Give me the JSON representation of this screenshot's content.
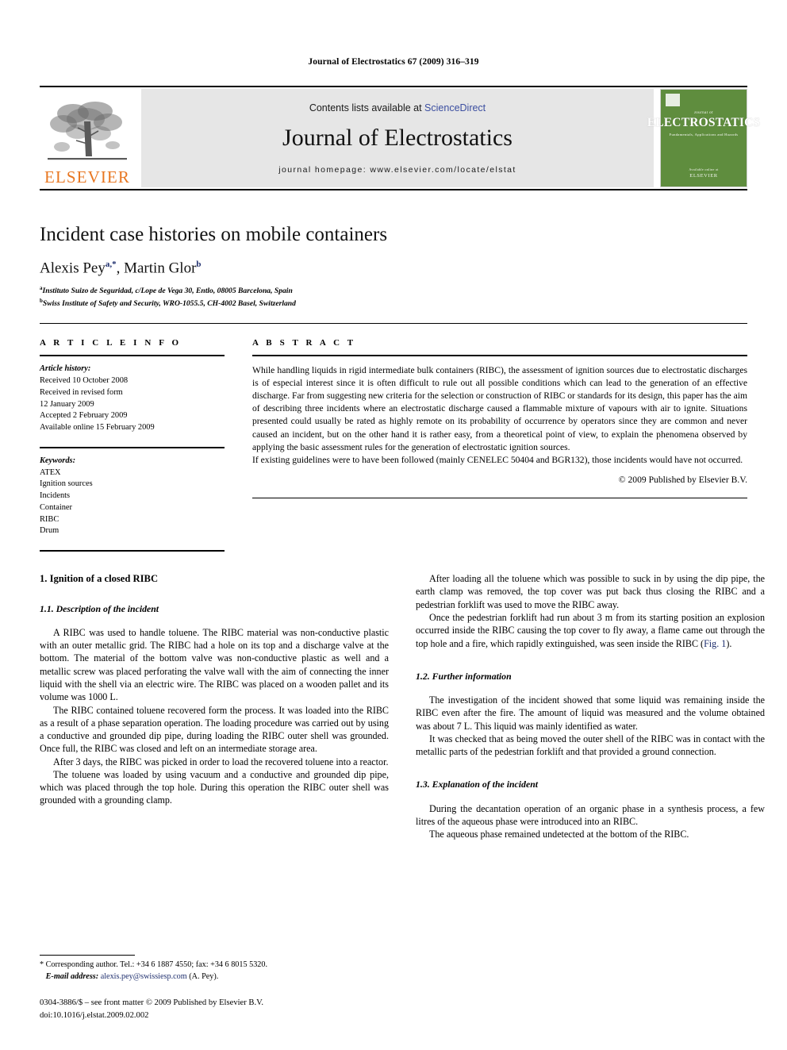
{
  "running_head": "Journal of Electrostatics 67 (2009) 316–319",
  "masthead": {
    "contents_prefix": "Contents lists available at ",
    "sciencedirect": "ScienceDirect",
    "journal_name": "Journal of Electrostatics",
    "homepage": "journal homepage: www.elsevier.com/locate/elstat",
    "publisher_wordmark": "ELSEVIER",
    "cover": {
      "kicker": "Journal of",
      "title": "ELECTROSTATICS",
      "subtitle": "Fundamentals, Applications and Hazards",
      "footer_note": "Available online at",
      "footer_brand": "ELSEVIER"
    },
    "link_color": "#3b4ea0",
    "panel_color": "#e6e6e6",
    "elsevier_orange": "#E87722",
    "cover_green": "#5f8d3e"
  },
  "article": {
    "title": "Incident case histories on mobile containers",
    "authors_html": "Alexis Pey, Martin Glor",
    "author1": "Alexis Pey",
    "author1_sup": "a,*",
    "author2": "Martin Glor",
    "author2_sup": "b",
    "affiliations": [
      {
        "marker": "a",
        "text": "Instituto Suizo de Seguridad, c/Lope de Vega 30, Entlo, 08005 Barcelona, Spain"
      },
      {
        "marker": "b",
        "text": "Swiss Institute of Safety and Security, WRO-1055.5, CH-4002 Basel, Switzerland"
      }
    ]
  },
  "article_info": {
    "heading": "A R T I C L E   I N F O",
    "history_label": "Article history:",
    "history": [
      "Received 10 October 2008",
      "Received in revised form",
      "12 January 2009",
      "Accepted 2 February 2009",
      "Available online 15 February 2009"
    ],
    "keywords_label": "Keywords:",
    "keywords": [
      "ATEX",
      "Ignition sources",
      "Incidents",
      "Container",
      "RIBC",
      "Drum"
    ]
  },
  "abstract": {
    "heading": "A B S T R A C T",
    "paragraphs": [
      "While handling liquids in rigid intermediate bulk containers (RIBC), the assessment of ignition sources due to electrostatic discharges is of especial interest since it is often difficult to rule out all possible conditions which can lead to the generation of an effective discharge. Far from suggesting new criteria for the selection or construction of RIBC or standards for its design, this paper has the aim of describing three incidents where an electrostatic discharge caused a flammable mixture of vapours with air to ignite. Situations presented could usually be rated as highly remote on its probability of occurrence by operators since they are common and never caused an incident, but on the other hand it is rather easy, from a theoretical point of view, to explain the phenomena observed by applying the basic assessment rules for the generation of electrostatic ignition sources.",
      "If existing guidelines were to have been followed (mainly CENELEC 50404 and BGR132), those incidents would have not occurred."
    ],
    "copyright": "© 2009 Published by Elsevier B.V."
  },
  "body": {
    "left_column": {
      "section_heading": "1.  Ignition of a closed RIBC",
      "subsection_heading": "1.1.  Description of the incident",
      "paragraphs": [
        "A RIBC was used to handle toluene. The RIBC material was non-conductive plastic with an outer metallic grid. The RIBC had a hole on its top and a discharge valve at the bottom. The material of the bottom valve was non-conductive plastic as well and a metallic screw was placed perforating the valve wall with the aim of connecting the inner liquid with the shell via an electric wire. The RIBC was placed on a wooden pallet and its volume was 1000 L.",
        "The RIBC contained toluene recovered form the process. It was loaded into the RIBC as a result of a phase separation operation. The loading procedure was carried out by using a conductive and grounded dip pipe, during loading the RIBC outer shell was grounded. Once full, the RIBC was closed and left on an intermediate storage area.",
        "After 3 days, the RIBC was picked in order to load the recovered toluene into a reactor.",
        "The toluene was loaded by using vacuum and a conductive and grounded dip pipe, which was placed through the top hole. During this operation the RIBC outer shell was grounded with a grounding clamp."
      ]
    },
    "right_column": {
      "paragraphs_top": [
        "After loading all the toluene which was possible to suck in by using the dip pipe, the earth clamp was removed, the top cover was put back thus closing the RIBC and a pedestrian forklift was used to move the RIBC away."
      ],
      "paragraph_with_xref_pre": "Once the pedestrian forklift had run about 3 m from its starting position an explosion occurred inside the RIBC causing the top cover to fly away, a flame came out through the top hole and a fire, which rapidly extinguished, was seen inside the RIBC (",
      "xref_label": "Fig. 1",
      "paragraph_with_xref_post": ").",
      "subsection_2_heading": "1.2.  Further information",
      "paragraphs_mid": [
        "The investigation of the incident showed that some liquid was remaining inside the RIBC even after the fire. The amount of liquid was measured and the volume obtained was about 7 L. This liquid was mainly identified as water.",
        "It was checked that as being moved the outer shell of the RIBC was in contact with the metallic parts of the pedestrian forklift and that provided a ground connection."
      ],
      "subsection_3_heading": "1.3.  Explanation of the incident",
      "paragraphs_bottom": [
        "During the decantation operation of an organic phase in a synthesis process, a few litres of the aqueous phase were introduced into an RIBC.",
        "The aqueous phase remained undetected at the bottom of the RIBC."
      ]
    }
  },
  "footnotes": {
    "corresponding": "* Corresponding author. Tel.: +34 6 1887 4550; fax: +34 6 8015 5320.",
    "email_label": "E-mail address:",
    "email": "alexis.pey@swissiesp.com",
    "email_suffix": "(A. Pey).",
    "issn_line": "0304-3886/$ – see front matter © 2009 Published by Elsevier B.V.",
    "doi_line": "doi:10.1016/j.elstat.2009.02.002"
  }
}
